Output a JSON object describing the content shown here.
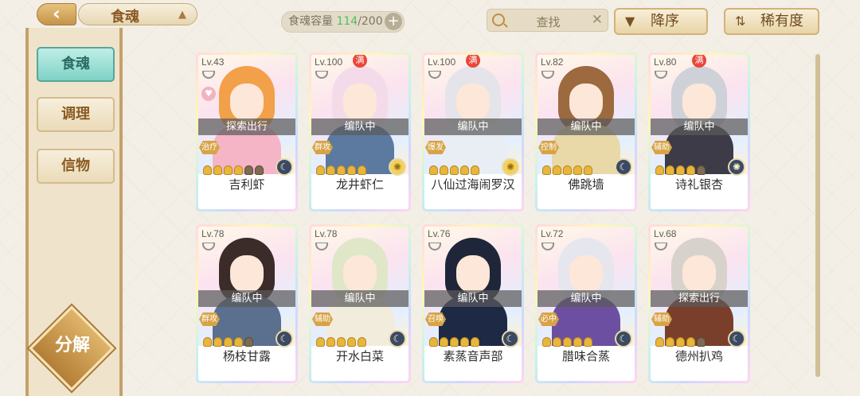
{
  "header": {
    "back_icon": "left-arrow-icon",
    "title": "食魂",
    "capacity_label": "食魂容量",
    "capacity_current": "114",
    "capacity_max": "/200",
    "capacity_add": "+",
    "search_placeholder": "查找",
    "search_clear": "✕",
    "sort_order_label": "降序",
    "sort_field_label": "稀有度"
  },
  "sidebar": {
    "tabs": [
      {
        "label": "食魂",
        "active": true
      },
      {
        "label": "调理",
        "active": false
      },
      {
        "label": "信物",
        "active": false
      }
    ],
    "decompose_label": "分解"
  },
  "cards": [
    {
      "level": "Lv.43",
      "full": "",
      "status": "探索出行",
      "role": "治疗",
      "stars": 4,
      "dim": 2,
      "element": "crescent",
      "element_style": "dark",
      "name": "吉利虾",
      "hair": "#f3a04a",
      "body": "#f5b5c6",
      "heart": "♥"
    },
    {
      "level": "Lv.100",
      "full": "满",
      "status": "编队中",
      "role": "群攻",
      "stars": 5,
      "dim": 0,
      "element": "sun",
      "element_style": "gold",
      "name": "龙井虾仁",
      "hair": "#f4dbe9",
      "body": "#5c7aa0",
      "heart": ""
    },
    {
      "level": "Lv.100",
      "full": "满",
      "status": "编队中",
      "role": "爆发",
      "stars": 5,
      "dim": 0,
      "element": "sun",
      "element_style": "gold",
      "name": "八仙过海闹罗汉",
      "hair": "#e4e4ea",
      "body": "#e8eef4",
      "heart": ""
    },
    {
      "level": "Lv.82",
      "full": "",
      "status": "编队中",
      "role": "控制",
      "stars": 5,
      "dim": 0,
      "element": "crescent",
      "element_style": "dark",
      "name": "佛跳墙",
      "hair": "#9c6a3e",
      "body": "#e9d9a8",
      "heart": ""
    },
    {
      "level": "Lv.80",
      "full": "满",
      "status": "编队中",
      "role": "辅助",
      "stars": 4,
      "dim": 1,
      "element": "sun",
      "element_style": "dark",
      "name": "诗礼银杏",
      "hair": "#cfd1d8",
      "body": "#3d3b47",
      "heart": ""
    },
    {
      "level": "Lv.78",
      "full": "",
      "status": "编队中",
      "role": "群攻",
      "stars": 4,
      "dim": 1,
      "element": "crescent",
      "element_style": "dark",
      "name": "杨枝甘露",
      "hair": "#3b2c2a",
      "body": "#5b6f8e",
      "heart": ""
    },
    {
      "level": "Lv.78",
      "full": "",
      "status": "编队中",
      "role": "辅助",
      "stars": 5,
      "dim": 0,
      "element": "crescent",
      "element_style": "dark",
      "name": "开水白菜",
      "hair": "#dfe7c8",
      "body": "#f2ecdc",
      "heart": ""
    },
    {
      "level": "Lv.76",
      "full": "",
      "status": "编队中",
      "role": "召唤",
      "stars": 5,
      "dim": 0,
      "element": "crescent",
      "element_style": "dark",
      "name": "素蒸音声部",
      "hair": "#1f2639",
      "body": "#1e2a45",
      "heart": ""
    },
    {
      "level": "Lv.72",
      "full": "",
      "status": "编队中",
      "role": "必中",
      "stars": 5,
      "dim": 0,
      "element": "crescent",
      "element_style": "dark",
      "name": "腊味合蒸",
      "hair": "#e6e6ef",
      "body": "#6d4fa1",
      "heart": ""
    },
    {
      "level": "Lv.68",
      "full": "",
      "status": "探索出行",
      "role": "辅助",
      "stars": 4,
      "dim": 1,
      "element": "crescent",
      "element_style": "dark",
      "name": "德州扒鸡",
      "hair": "#d7d3cc",
      "body": "#7a3f2b",
      "heart": ""
    }
  ]
}
